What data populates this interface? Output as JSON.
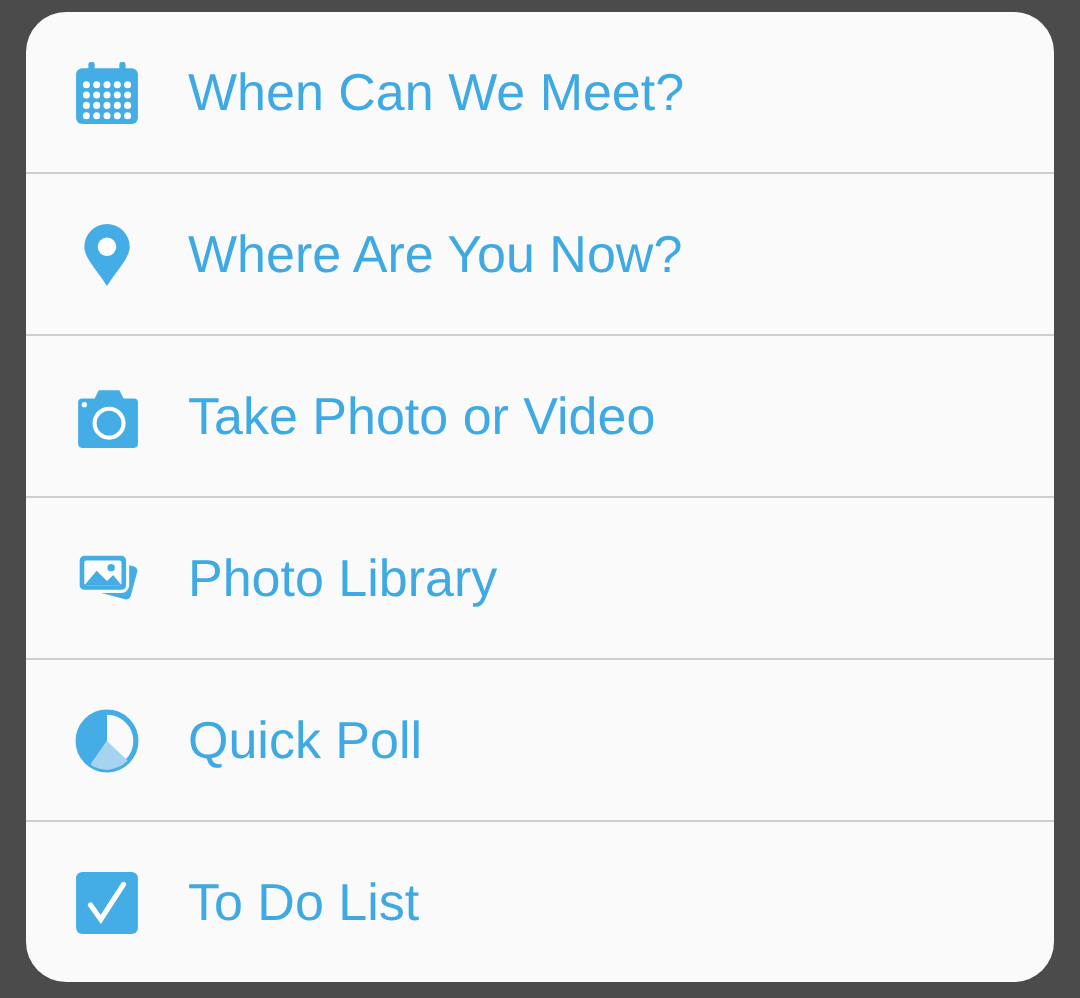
{
  "menu": {
    "items": [
      {
        "kind": "calendar",
        "label": "When Can We Meet?"
      },
      {
        "kind": "location",
        "label": "Where Are You Now?"
      },
      {
        "kind": "camera",
        "label": "Take Photo or Video"
      },
      {
        "kind": "photos",
        "label": "Photo Library"
      },
      {
        "kind": "poll",
        "label": "Quick Poll"
      },
      {
        "kind": "todo",
        "label": "To Do List"
      }
    ]
  }
}
